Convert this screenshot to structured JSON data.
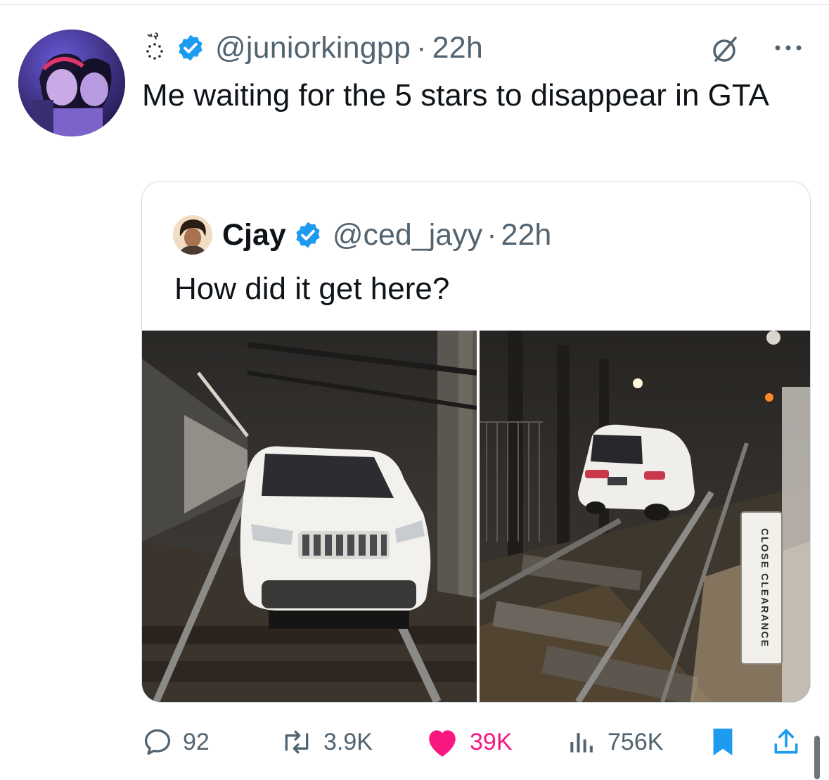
{
  "tweet": {
    "handle": "@juniorkingpp",
    "separator": "·",
    "time": "22h",
    "text": "Me waiting for the 5 stars to disappear in GTA",
    "avatar_icon": "anime-couple-avatar",
    "badge_color": "#1d9bf0"
  },
  "quote": {
    "name": "Cjay",
    "handle": "@ced_jayy",
    "separator": "·",
    "time": "22h",
    "text": "How did it get here?",
    "sign_text": "CLOSE CLEARANCE"
  },
  "actions": {
    "replies": "92",
    "reposts": "3.9K",
    "likes": "39K",
    "views": "756K",
    "like_color": "#f91880"
  }
}
